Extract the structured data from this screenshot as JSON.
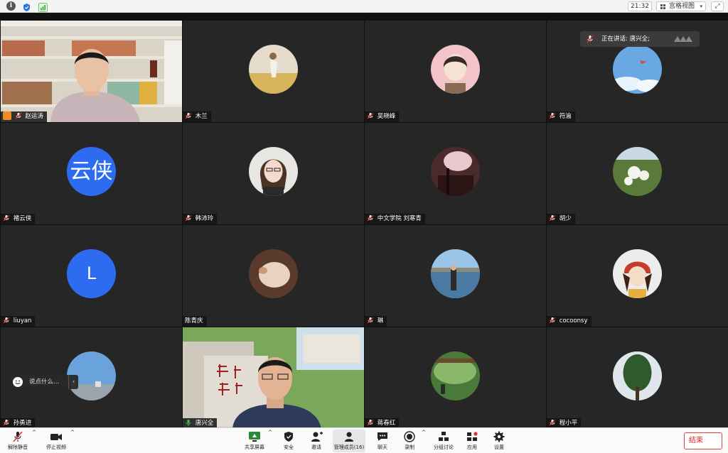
{
  "topbar": {
    "time": "21:32",
    "view_label": "宫格视图",
    "view_caret": "▾",
    "fullscreen_icon": "⤢",
    "info_icon": "i"
  },
  "speaking": {
    "text": "正在讲话: 唐兴全;"
  },
  "participants": [
    {
      "name": "赵运涛",
      "type": "video"
    },
    {
      "name": "木兰",
      "type": "avatar"
    },
    {
      "name": "吴晓峰",
      "type": "avatar"
    },
    {
      "name": "符渝",
      "type": "avatar"
    },
    {
      "name": "褚云侠",
      "type": "initial",
      "initial": "云侠"
    },
    {
      "name": "韩沛玲",
      "type": "avatar"
    },
    {
      "name": "中文学院 刘寒青",
      "type": "avatar"
    },
    {
      "name": "胡少",
      "type": "avatar"
    },
    {
      "name": "liuyan",
      "type": "initial",
      "initial": "L"
    },
    {
      "name": "陈青庆",
      "type": "avatar"
    },
    {
      "name": "琳",
      "type": "avatar"
    },
    {
      "name": "cocoonsy",
      "type": "avatar"
    },
    {
      "name": "孙勇进",
      "type": "avatar"
    },
    {
      "name": "唐兴全",
      "type": "video"
    },
    {
      "name": "蒋春红",
      "type": "avatar"
    },
    {
      "name": "程小平",
      "type": "avatar"
    }
  ],
  "chat_float": {
    "placeholder": "说点什么...",
    "arrow": "‹"
  },
  "toolbar": {
    "unmute": "解除静音",
    "stop_video": "停止视频",
    "share": "共享屏幕",
    "security": "安全",
    "invite": "邀请",
    "participants": "管理成员(16)",
    "chat": "聊天",
    "record": "录制",
    "breakout": "分组讨论",
    "apps": "应用",
    "settings": "设置",
    "end": "结束",
    "caret": "^"
  },
  "colors": {
    "accent_blue": "#2d6cf0",
    "active_border": "#3cc94d",
    "end_red": "#e02020"
  }
}
